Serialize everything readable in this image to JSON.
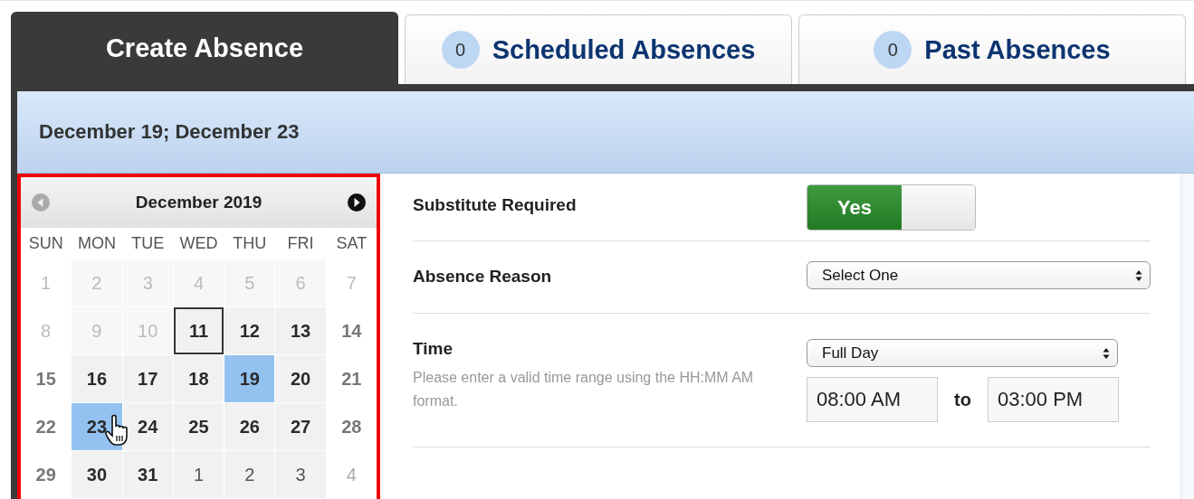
{
  "tabs": [
    {
      "label": "Create Absence",
      "selected": true
    },
    {
      "label": "Scheduled Absences",
      "count": "0",
      "selected": false
    },
    {
      "label": "Past Absences",
      "count": "0",
      "selected": false
    }
  ],
  "header": {
    "title": "December 19; December 23"
  },
  "calendar": {
    "month": "December 2019",
    "weekdays": [
      "SUN",
      "MON",
      "TUE",
      "WED",
      "THU",
      "FRI",
      "SAT"
    ],
    "days": [
      {
        "day": "1",
        "kind": "past",
        "selected": false,
        "today": false
      },
      {
        "day": "2",
        "kind": "past",
        "selected": false,
        "today": false
      },
      {
        "day": "3",
        "kind": "past",
        "selected": false,
        "today": false
      },
      {
        "day": "4",
        "kind": "past",
        "selected": false,
        "today": false
      },
      {
        "day": "5",
        "kind": "past",
        "selected": false,
        "today": false
      },
      {
        "day": "6",
        "kind": "past",
        "selected": false,
        "today": false
      },
      {
        "day": "7",
        "kind": "past",
        "selected": false,
        "today": false
      },
      {
        "day": "8",
        "kind": "past",
        "selected": false,
        "today": false
      },
      {
        "day": "9",
        "kind": "past",
        "selected": false,
        "today": false
      },
      {
        "day": "10",
        "kind": "past",
        "selected": false,
        "today": false
      },
      {
        "day": "11",
        "kind": "open",
        "selected": false,
        "today": true
      },
      {
        "day": "12",
        "kind": "open",
        "selected": false,
        "today": false
      },
      {
        "day": "13",
        "kind": "open",
        "selected": false,
        "today": false
      },
      {
        "day": "14",
        "kind": "weekend",
        "selected": false,
        "today": false
      },
      {
        "day": "15",
        "kind": "weekend",
        "selected": false,
        "today": false
      },
      {
        "day": "16",
        "kind": "open",
        "selected": false,
        "today": false
      },
      {
        "day": "17",
        "kind": "open",
        "selected": false,
        "today": false
      },
      {
        "day": "18",
        "kind": "open",
        "selected": false,
        "today": false
      },
      {
        "day": "19",
        "kind": "open",
        "selected": true,
        "today": false
      },
      {
        "day": "20",
        "kind": "open",
        "selected": false,
        "today": false
      },
      {
        "day": "21",
        "kind": "weekend",
        "selected": false,
        "today": false
      },
      {
        "day": "22",
        "kind": "weekend",
        "selected": false,
        "today": false
      },
      {
        "day": "23",
        "kind": "open",
        "selected": true,
        "today": false
      },
      {
        "day": "24",
        "kind": "open",
        "selected": false,
        "today": false
      },
      {
        "day": "25",
        "kind": "open",
        "selected": false,
        "today": false
      },
      {
        "day": "26",
        "kind": "open",
        "selected": false,
        "today": false
      },
      {
        "day": "27",
        "kind": "open",
        "selected": false,
        "today": false
      },
      {
        "day": "28",
        "kind": "weekend",
        "selected": false,
        "today": false
      },
      {
        "day": "29",
        "kind": "weekend",
        "selected": false,
        "today": false
      },
      {
        "day": "30",
        "kind": "open",
        "selected": false,
        "today": false
      },
      {
        "day": "31",
        "kind": "open",
        "selected": false,
        "today": false
      },
      {
        "day": "1",
        "kind": "other_month",
        "selected": false,
        "today": false
      },
      {
        "day": "2",
        "kind": "other_month",
        "selected": false,
        "today": false
      },
      {
        "day": "3",
        "kind": "other_month",
        "selected": false,
        "today": false
      },
      {
        "day": "4",
        "kind": "other_month_weekend",
        "selected": false,
        "today": false
      }
    ]
  },
  "form": {
    "substitute": {
      "label": "Substitute Required",
      "toggle": {
        "label": "Yes",
        "on": true
      }
    },
    "reason": {
      "label": "Absence Reason",
      "select": "Select One"
    },
    "time": {
      "label": "Time",
      "hint": "Please enter a valid time range using the HH:MM AM format.",
      "select": "Full Day",
      "start": "08:00 AM",
      "separator": "to",
      "end": "03:00 PM"
    }
  }
}
